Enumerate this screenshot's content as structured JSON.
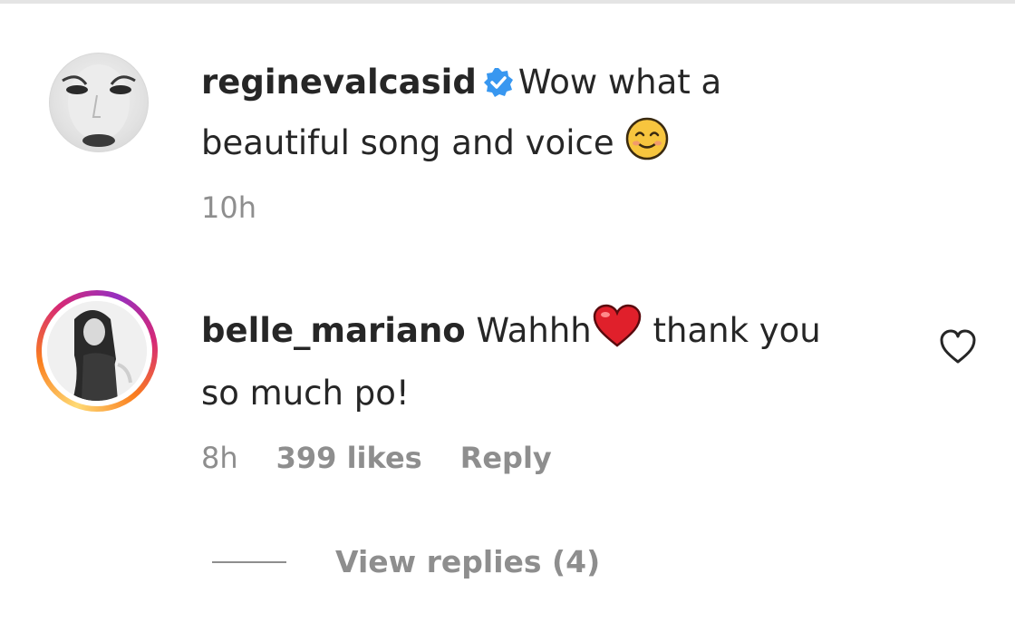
{
  "comments": [
    {
      "username": "reginevalcasid",
      "verified": true,
      "text_line1": "Wow what a",
      "text_line2": "beautiful song and voice",
      "emoji": "smiling-face-with-smiling-eyes",
      "time": "10h"
    },
    {
      "username": "belle_mariano",
      "text_before_emoji": "Wahhh",
      "emoji": "red-heart",
      "text_after_emoji": " thank you",
      "text_line2": "so much po!",
      "time": "8h",
      "likes": "399 likes",
      "reply_label": "Reply",
      "like_icon": "heart-outline-icon"
    }
  ],
  "view_replies_label": "View replies (4)",
  "colors": {
    "text": "#262626",
    "secondary": "#8e8e8e",
    "verified": "#3897f0",
    "story_ring": [
      "#feda75",
      "#fa7e1e",
      "#d62976",
      "#962fbf"
    ]
  }
}
